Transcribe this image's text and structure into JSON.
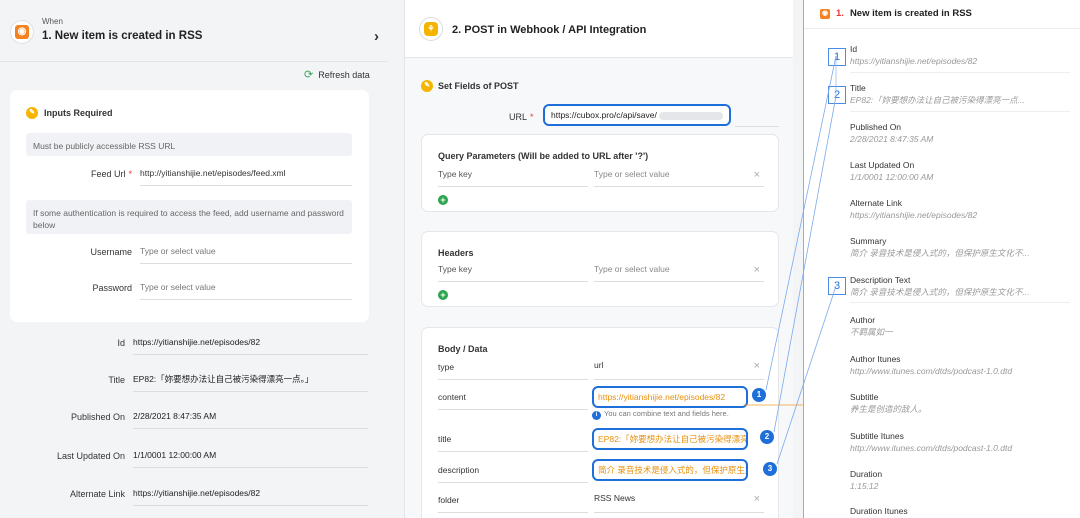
{
  "trigger": {
    "when": "When",
    "title": "1. New item is created in RSS",
    "refresh": "Refresh data"
  },
  "inputs": {
    "title": "Inputs Required",
    "note_public": "Must be publicly accessible RSS URL",
    "feed_label": "Feed Url",
    "feed_value": "http://yitianshijie.net/episodes/feed.xml",
    "note_auth": "If some authentication is required to access the feed, add username and password below",
    "username_label": "Username",
    "username_placeholder": "Type or select value",
    "password_label": "Password",
    "password_placeholder": "Type or select value"
  },
  "outputs": [
    {
      "label": "Id",
      "value": "https://yitianshijie.net/episodes/82"
    },
    {
      "label": "Title",
      "value": "EP82:「妳要想办法让自己被污染得漂亮一点。」"
    },
    {
      "label": "Published On",
      "value": "2/28/2021 8:47:35 AM"
    },
    {
      "label": "Last Updated On",
      "value": "1/1/0001 12:00:00 AM"
    },
    {
      "label": "Alternate Link",
      "value": "https://yitianshijie.net/episodes/82"
    }
  ],
  "action": {
    "title": "2. POST in Webhook / API Integration",
    "set_fields": "Set Fields of POST",
    "url_label": "URL",
    "url_value": "https://cubox.pro/c/api/save/",
    "query_title": "Query Parameters (Will be added to URL after '?')",
    "headers_title": "Headers",
    "key_placeholder": "Type key",
    "value_placeholder": "Type or select value",
    "body_title": "Body / Data",
    "hint": "You can combine text and fields here.",
    "body": [
      {
        "key": "type",
        "value": "url"
      },
      {
        "key": "content",
        "value": "https://yitianshijie.net/episodes/82"
      },
      {
        "key": "title",
        "value": "EP82:「妳要想办法让自己被污染得漂亮一"
      },
      {
        "key": "description",
        "value": "简介 录音技术是侵入式的，但保护原生文"
      },
      {
        "key": "folder",
        "value": "RSS News"
      }
    ]
  },
  "fields": {
    "header_num": "1.",
    "header_title": "New item is created in RSS",
    "items": [
      {
        "label": "Id",
        "value": "https://yitianshijie.net/episodes/82"
      },
      {
        "label": "Title",
        "value": "EP82:「妳要想办法让自己被污染得漂亮一点..."
      },
      {
        "label": "Published On",
        "value": "2/28/2021 8:47:35 AM"
      },
      {
        "label": "Last Updated On",
        "value": "1/1/0001 12:00:00 AM"
      },
      {
        "label": "Alternate Link",
        "value": "https://yitianshijie.net/episodes/82"
      },
      {
        "label": "Summary",
        "value": "简介 录音技术是侵入式的，但保护原生文化不..."
      },
      {
        "label": "Description Text",
        "value": "简介 录音技术是侵入式的，但保护原生文化不..."
      },
      {
        "label": "Author",
        "value": "不羁属如一"
      },
      {
        "label": "Author Itunes",
        "value": "http://www.itunes.com/dtds/podcast-1.0.dtd"
      },
      {
        "label": "Subtitle",
        "value": "养生是创造的敌人。"
      },
      {
        "label": "Subtitle Itunes",
        "value": "http://www.itunes.com/dtds/podcast-1.0.dtd"
      },
      {
        "label": "Duration",
        "value": "1:15:12"
      },
      {
        "label": "Duration Itunes",
        "value": ""
      }
    ]
  },
  "markers": [
    "1",
    "2",
    "3"
  ],
  "icons": {
    "rss": "rss-icon",
    "webhook": "webhook-icon",
    "refresh": "refresh-icon",
    "chevron": "chevron-right-icon",
    "close": "close-icon",
    "add": "add-icon",
    "info": "info-icon"
  },
  "colors": {
    "accent_blue": "#1e6fd9",
    "rss_orange": "#f58220",
    "highlight_text": "#e8900c",
    "required": "#e53935",
    "add_green": "#2da44e"
  }
}
